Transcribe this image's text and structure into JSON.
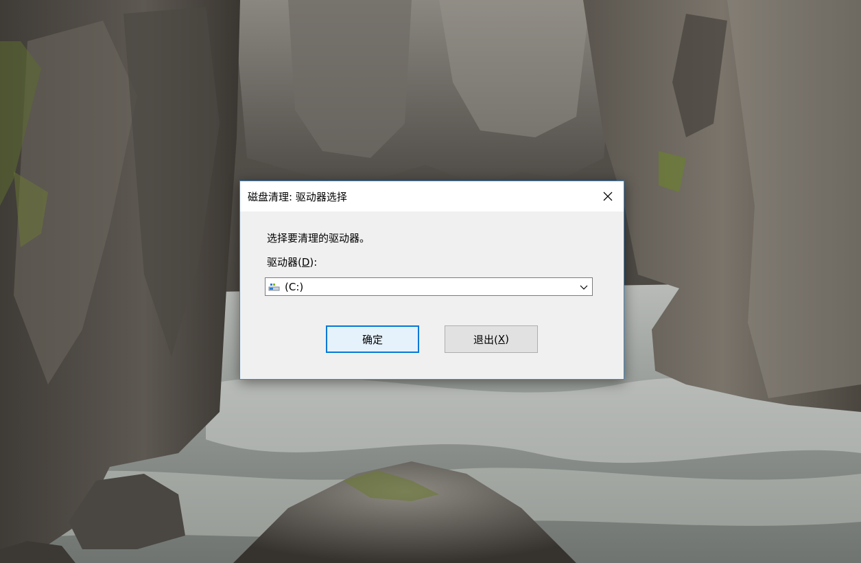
{
  "dialog": {
    "title": "磁盘清理: 驱动器选择",
    "prompt": "选择要清理的驱动器。",
    "drive_label": {
      "prefix": "驱动器(",
      "accel": "D",
      "suffix": "):"
    },
    "drive_select": {
      "selected_value": "(C:)",
      "icon": "drive-icon"
    },
    "buttons": {
      "ok_label": "确定",
      "exit_label": {
        "prefix": "退出(",
        "accel": "X",
        "suffix": ")"
      }
    },
    "close_icon": "close-icon"
  },
  "colors": {
    "accent": "#0078d7",
    "window_border": "#3c86c8",
    "dialog_bg": "#f0f0f0"
  }
}
